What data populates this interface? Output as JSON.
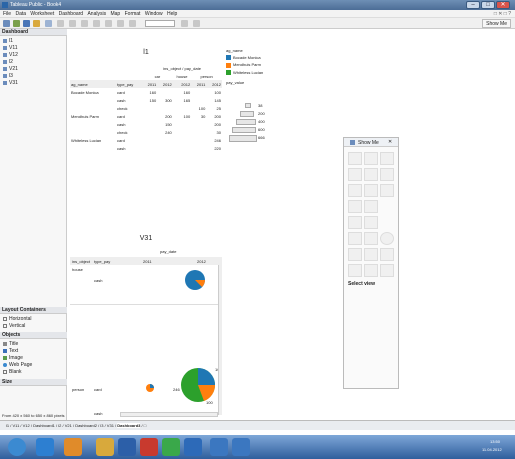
{
  "window": {
    "title": "Tableau Public - Book4",
    "min": "–",
    "max": "□",
    "close": "✕"
  },
  "menu": [
    "File",
    "Data",
    "Worksheet",
    "Dashboard",
    "Analysis",
    "Map",
    "Format",
    "Window",
    "Help"
  ],
  "toolbar": {
    "show_me": "Show Me",
    "inner_controls": "□ ✕ □ ?"
  },
  "left": {
    "dashboard_header": "Dashboard",
    "sheets": [
      "l1",
      "V11",
      "V12",
      "l2",
      "V21",
      "l3",
      "V31"
    ],
    "layout_header": "Layout Containers",
    "layout_items": [
      "Horizontal",
      "Vertical"
    ],
    "objects_header": "Objects",
    "object_items": [
      "Title",
      "Text",
      "Image",
      "Web Page",
      "Blank"
    ],
    "size_header": "Size",
    "size_value": "From 420 x 560 to 650 x 860 pixels",
    "edit_label": "Edit..."
  },
  "sheet1": {
    "title": "l1",
    "col_group": "ins_object / pay_date",
    "objects": [
      "car",
      "house",
      "person"
    ],
    "years": [
      "2011",
      "2012",
      "2012",
      "2011",
      "2012"
    ],
    "row_headers": [
      "ag_name",
      "type_pay"
    ],
    "rows": [
      {
        "ag": "Bocade Monica",
        "type": "card",
        "v": [
          "160",
          "",
          "160",
          "",
          "100"
        ]
      },
      {
        "ag": "",
        "type": "cash",
        "v": [
          "150",
          "300",
          "165",
          "",
          "145"
        ]
      },
      {
        "ag": "",
        "type": "check",
        "v": [
          "",
          "",
          "",
          "100",
          "25"
        ]
      },
      {
        "ag": "Mendhuis Parm",
        "type": "card",
        "v": [
          "",
          "200",
          "100",
          "30",
          "200"
        ]
      },
      {
        "ag": "",
        "type": "cash",
        "v": [
          "",
          "150",
          "",
          "",
          "200"
        ]
      },
      {
        "ag": "",
        "type": "check",
        "v": [
          "",
          "240",
          "",
          "",
          "30"
        ]
      },
      {
        "ag": "Whiteless Lucian",
        "type": "card",
        "v": [
          "",
          "",
          "",
          "",
          "246"
        ]
      },
      {
        "ag": "",
        "type": "cash",
        "v": [
          "",
          "",
          "",
          "",
          "220"
        ]
      }
    ]
  },
  "legend": {
    "color_title": "ag_name",
    "color_items": [
      {
        "label": "Bocade Monica",
        "color": "#1f77b4"
      },
      {
        "label": "Mendhuis Parm",
        "color": "#ff7f0e"
      },
      {
        "label": "Whiteless Lucian",
        "color": "#2ca02c"
      }
    ],
    "size_title": "pay_value",
    "size_items": [
      "38",
      "200",
      "400",
      "600",
      "666"
    ]
  },
  "showme": {
    "title": "Show Me",
    "select_view": "Select view"
  },
  "sheet2": {
    "title": "V31",
    "col_header": "pay_date",
    "row_headers": [
      "ins_object",
      "type_pay"
    ],
    "years": [
      "2011",
      "2012"
    ],
    "rows": [
      {
        "obj": "house",
        "type": "cash"
      },
      {
        "obj": "person",
        "type": "card"
      },
      {
        "obj": "",
        "type": "cash"
      }
    ],
    "pie_labels": [
      "100",
      "246",
      "100"
    ]
  },
  "tabs": [
    "l1",
    "V11",
    "V12",
    "Dashboard1",
    "l2",
    "V21",
    "Dashboard2",
    "l3",
    "V31",
    "Dashboard3",
    "□"
  ],
  "taskbar": {
    "time": "13:50",
    "date": "11.04.2012"
  }
}
